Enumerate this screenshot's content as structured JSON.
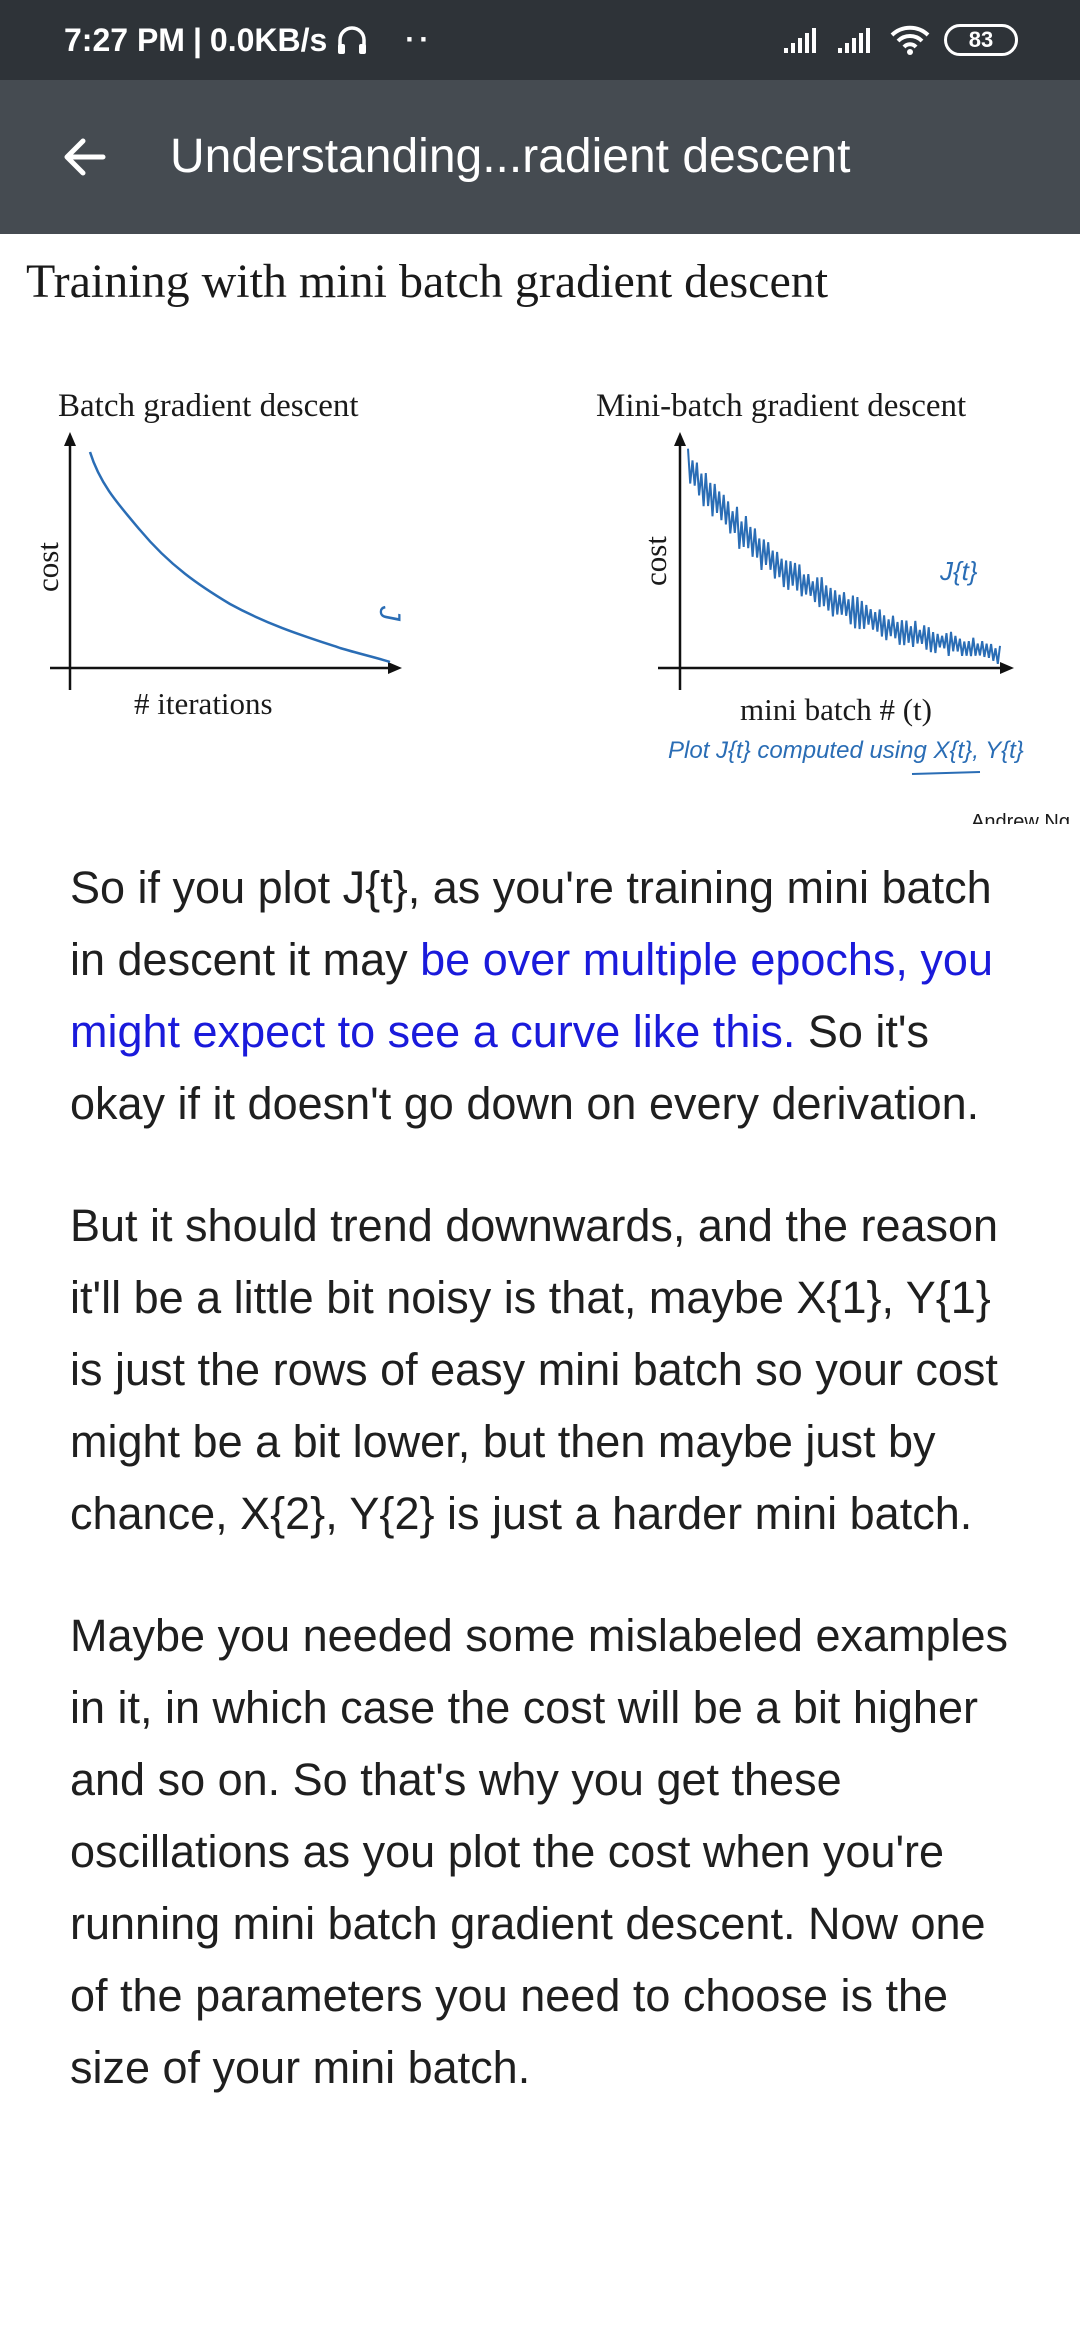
{
  "status_bar": {
    "time": "7:27 PM",
    "separator": "|",
    "net_speed": "0.0KB/s",
    "headset_icon": "headset-icon",
    "dots": "··",
    "battery": "83"
  },
  "app_bar": {
    "back_icon": "back-arrow-icon",
    "title": "Understanding...radient descent"
  },
  "slide": {
    "title": "Training with mini batch gradient descent",
    "credit": "Andrew Ng",
    "batch_chart": {
      "title": "Batch gradient descent",
      "ylabel": "cost",
      "xlabel": "# iterations",
      "curve_annotation": "J"
    },
    "minibatch_chart": {
      "title": "Mini-batch gradient descent",
      "ylabel": "cost",
      "xlabel": "mini batch # (t)",
      "curve_annotation": "J{t}",
      "handwritten_note": "Plot J{t} computed using X{t}, Y{t}"
    }
  },
  "article": {
    "p1_a": "So if you plot J{t}, as you're training mini batch in descent it may ",
    "p1_highlight": "be over multiple epochs, you might expect to see a curve like this.",
    "p1_b": " So it's okay if it doesn't go down on every derivation.",
    "p2": "But it should trend downwards, and the reason it'll be a little bit noisy is that, maybe X{1}, Y{1} is just the rows of easy mini batch so your cost might be a bit lower, but then maybe just by chance, X{2}, Y{2} is just a harder mini batch.",
    "p3": "Maybe you needed some mislabeled examples in it, in which case the cost will be a bit higher and so on. So that's why you get these oscillations as you plot the cost when you're running mini batch gradient descent. Now one of the parameters you need to choose is the size of your mini batch."
  },
  "colors": {
    "status_bar_bg": "#2e3338",
    "app_bar_bg": "#454b51",
    "highlight_text": "#1a1adb",
    "pen_blue": "#2a6db5"
  }
}
